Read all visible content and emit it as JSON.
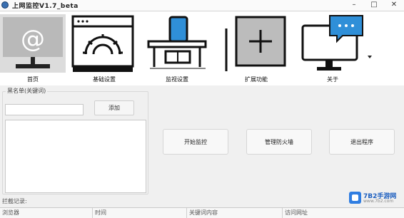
{
  "window": {
    "title": "上网监控V1.7_beta",
    "controls": {
      "minimize": "–",
      "maximize": "□",
      "close": "✕"
    }
  },
  "toolbar": {
    "items": [
      {
        "label": "首页",
        "icon": "at-monitor-icon"
      },
      {
        "label": "基础设置",
        "icon": "gear-icon"
      },
      {
        "label": "监视设置",
        "icon": "desk-chair-icon"
      },
      {
        "label": "扩展功能",
        "icon": "plus-box-icon"
      },
      {
        "label": "关于",
        "icon": "chat-monitor-icon"
      }
    ],
    "more_icon": "chevron-down-icon"
  },
  "blacklist": {
    "legend": "黑名单(关键词)",
    "input_value": "",
    "add_label": "添加"
  },
  "actions": {
    "start": "开始监控",
    "firewall": "管理防火墙",
    "exit": "退出程序"
  },
  "log": {
    "label": "拦截记录:",
    "columns": [
      "浏览器",
      "时间",
      "关键词内容",
      "访问网址"
    ]
  },
  "watermark": {
    "name": "7B2手游网",
    "site": "www.7b2.com"
  },
  "colors": {
    "accent": "#2f8fd8",
    "panel": "#f0f0f0",
    "toolbar": "#ffffff"
  }
}
